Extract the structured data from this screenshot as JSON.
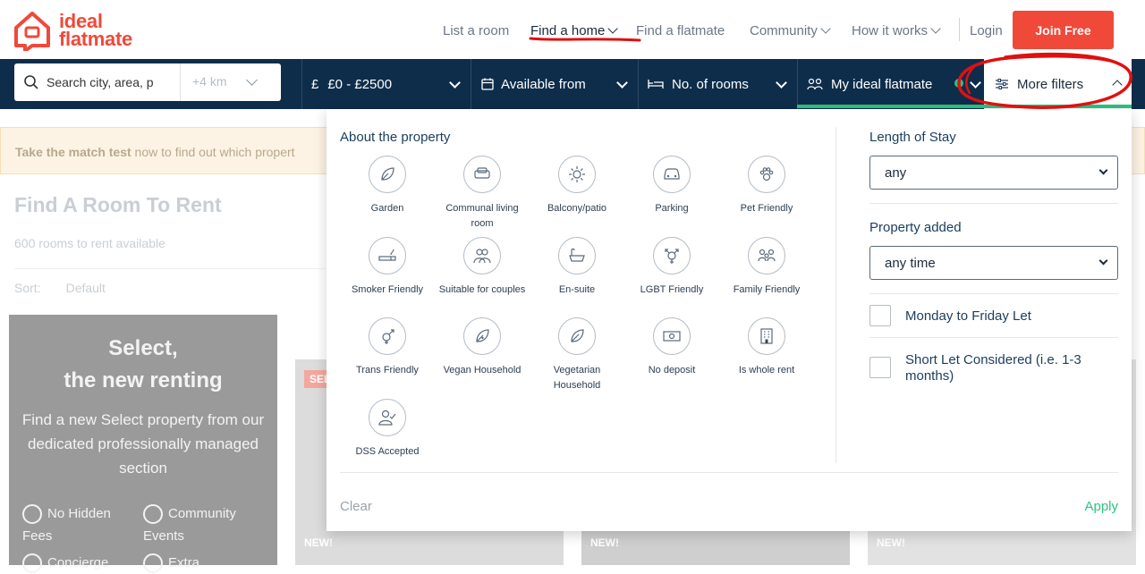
{
  "header": {
    "logo_line1": "ideal",
    "logo_line2": "flatmate",
    "nav": {
      "list_room": "List a room",
      "find_home": "Find a home",
      "find_flatmate": "Find a flatmate",
      "community": "Community",
      "how_it_works": "How it works",
      "login": "Login",
      "join": "Join Free"
    }
  },
  "filterbar": {
    "search_placeholder": "Search city, area, p",
    "radius": "+4 km",
    "price": "£0 - £2500",
    "available_from": "Available from",
    "rooms": "No. of rooms",
    "ideal_flatmate": "My ideal flatmate",
    "more_filters": "More filters"
  },
  "background": {
    "banner_bold": "Take the match test",
    "banner_rest": " now to find out which propert",
    "title": "Find A Room To Rent",
    "count": "600 rooms to rent available",
    "sort_label": "Sort:",
    "sort_value": "Default",
    "promo": {
      "title_line1": "Select,",
      "title_line2": "the new renting",
      "sub": "Find a new Select property from our dedicated professionally managed section",
      "feat1": "No Hidden Fees",
      "feat2": "Community Events",
      "feat3": "Concierge",
      "feat4": "Extra"
    },
    "card_tag_sel": "SEL",
    "card_new": "NEW!"
  },
  "panel": {
    "about_title": "About the property",
    "amenities": [
      {
        "label": "Garden",
        "icon": "leaf-icon"
      },
      {
        "label": "Communal living room",
        "icon": "sofa-icon"
      },
      {
        "label": "Balcony/patio",
        "icon": "sun-icon"
      },
      {
        "label": "Parking",
        "icon": "car-icon"
      },
      {
        "label": "Pet Friendly",
        "icon": "paw-icon"
      },
      {
        "label": "Smoker Friendly",
        "icon": "cigarette-icon"
      },
      {
        "label": "Suitable for couples",
        "icon": "couple-icon"
      },
      {
        "label": "En-suite",
        "icon": "bath-icon"
      },
      {
        "label": "LGBT Friendly",
        "icon": "gender-icon"
      },
      {
        "label": "Family Friendly",
        "icon": "family-icon"
      },
      {
        "label": "Trans Friendly",
        "icon": "trans-icon"
      },
      {
        "label": "Vegan Household",
        "icon": "vegan-leaf-icon"
      },
      {
        "label": "Vegetarian Household",
        "icon": "veg-leaf-icon"
      },
      {
        "label": "No deposit",
        "icon": "banknote-icon"
      },
      {
        "label": "Is whole rent",
        "icon": "building-icon"
      },
      {
        "label": "DSS Accepted",
        "icon": "user-check-icon"
      }
    ],
    "length_title": "Length of Stay",
    "length_value": "any",
    "added_title": "Property added",
    "added_value": "any time",
    "check1": "Monday to Friday Let",
    "check2": "Short Let Considered (i.e. 1-3 months)",
    "clear": "Clear",
    "apply": "Apply"
  },
  "colors": {
    "brand_red": "#f0493a",
    "navy": "#0e2d4b",
    "green": "#2ec27e"
  }
}
